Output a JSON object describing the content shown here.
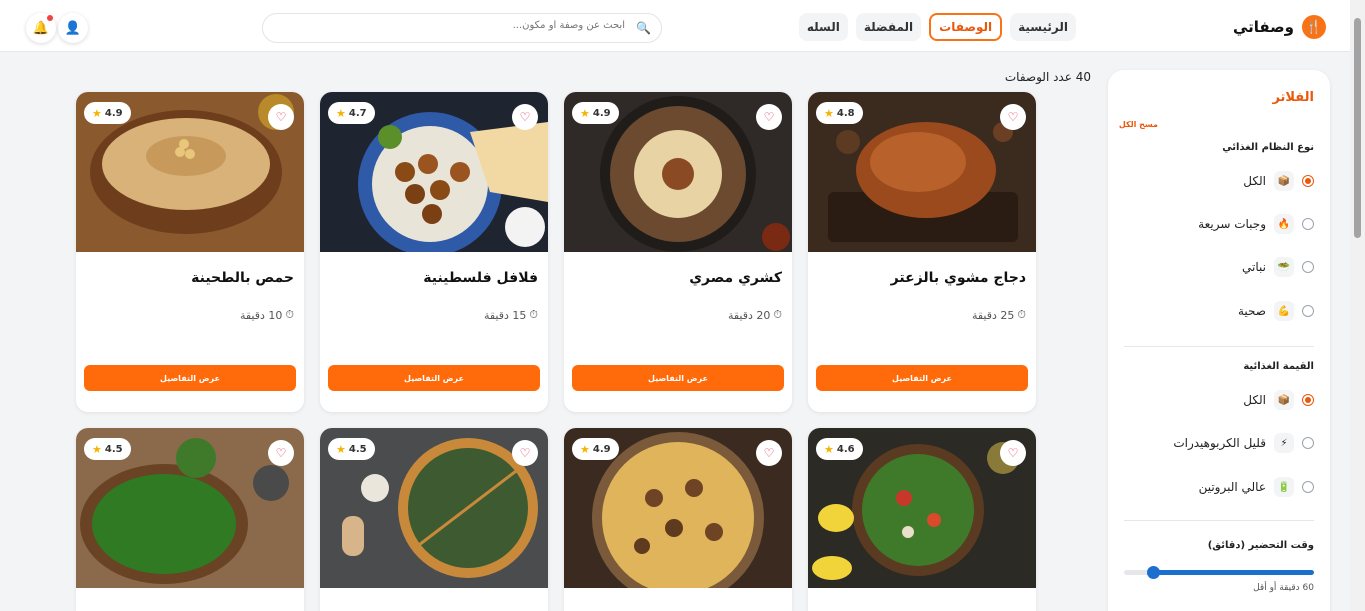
{
  "header": {
    "logo_text": "وصفاتي",
    "nav": [
      "الرئيسية",
      "الوصفات",
      "المفضلة",
      "السله"
    ],
    "active_nav": "الوصفات",
    "search_placeholder": "ابحث عن وصفة أو مكون..."
  },
  "recipes_count": "40 عدد الوصفات",
  "filters": {
    "title": "الفلاتر",
    "clear_all": "مسح الكل",
    "diet_title": "نوع النظام الغذائي",
    "diet_options": [
      {
        "label": "الكل",
        "icon": "box-icon",
        "checked": true
      },
      {
        "label": "وجبات سريعة",
        "icon": "fire-icon",
        "checked": false
      },
      {
        "label": "نباتي",
        "icon": "salad-icon",
        "checked": false
      },
      {
        "label": "صحية",
        "icon": "muscle-icon",
        "checked": false
      }
    ],
    "nutrition_title": "القيمة الغذائية",
    "nutrition_options": [
      {
        "label": "الكل",
        "icon": "box-icon",
        "checked": true
      },
      {
        "label": "قليل الكربوهيدرات",
        "icon": "lightning-icon",
        "checked": false
      },
      {
        "label": "عالي البروتين",
        "icon": "battery-icon",
        "checked": false
      }
    ],
    "prep_time_title": "وقت التحضير (دقائق)",
    "prep_time_value": 0.84,
    "prep_time_label": "60 دقيقة أو أقل"
  },
  "recipes": [
    {
      "title": "دجاج مشوي بالزعتر",
      "time": "25 دقيقة",
      "rating": "4.8",
      "button": "عرض التفاصيل"
    },
    {
      "title": "كشري مصري",
      "time": "20 دقيقة",
      "rating": "4.9",
      "button": "عرض التفاصيل"
    },
    {
      "title": "فلافل فلسطينية",
      "time": "15 دقيقة",
      "rating": "4.7",
      "button": "عرض التفاصيل"
    },
    {
      "title": "حمص بالطحينة",
      "time": "10 دقيقة",
      "rating": "4.9",
      "button": "عرض التفاصيل"
    },
    {
      "title": "",
      "time": "",
      "rating": "4.6",
      "button": ""
    },
    {
      "title": "",
      "time": "",
      "rating": "4.9",
      "button": ""
    },
    {
      "title": "",
      "time": "",
      "rating": "4.5",
      "button": ""
    },
    {
      "title": "",
      "time": "",
      "rating": "4.5",
      "button": ""
    }
  ],
  "colors": {
    "accent": "#ff6a0a",
    "heart": "#e11d48",
    "star": "#f5b301",
    "slider": "#1d6fcf"
  }
}
